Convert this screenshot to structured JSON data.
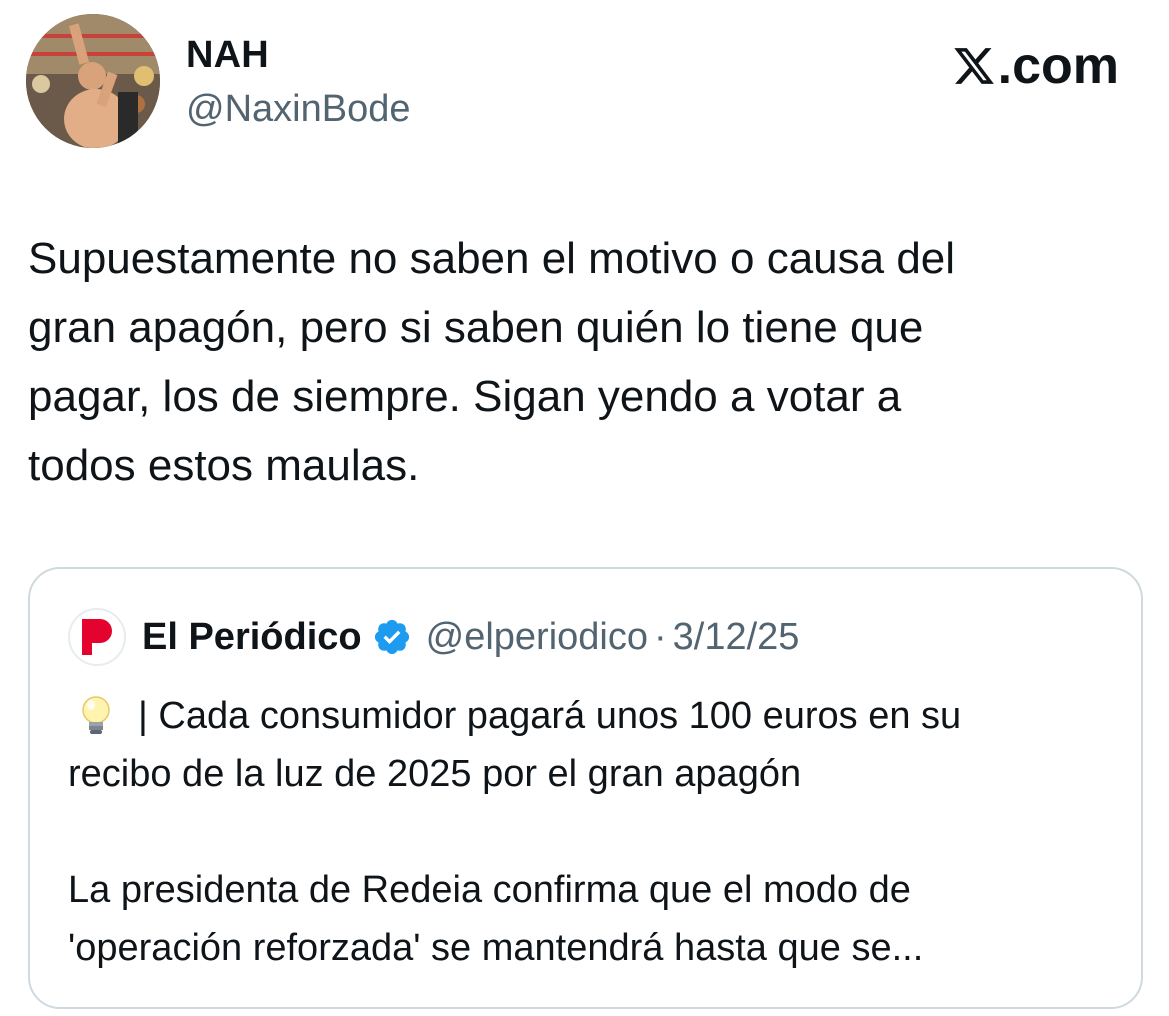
{
  "author": {
    "name": "NAH",
    "handle": "@NaxinBode"
  },
  "brand": {
    "label": ".com",
    "icon": "x-logo-icon"
  },
  "tweet": {
    "text": "Supuestamente no saben el motivo o causa del\ngran apagón, pero si saben quién lo tiene que\npagar, los de siempre. Sigan yendo a votar a\ntodos estos maulas."
  },
  "quote": {
    "logo_icon": "el-periodico-logo-icon",
    "name": "El Periódico",
    "verified_icon": "verified-badge-icon",
    "handle": "@elperiodico",
    "separator": "·",
    "date": "3/12/25",
    "emoji_icon": "light-bulb-icon",
    "line1": "| Cada consumidor pagará unos 100 euros en su",
    "line2": "recibo de la luz de 2025 por el gran apagón",
    "para2": "La presidenta de Redeia confirma que el modo de\n'operación reforzada' se mantendrá hasta que se..."
  },
  "colors": {
    "text": "#0f1419",
    "secondary": "#536471",
    "border": "#cfd9de",
    "verified": "#1d9bf0",
    "periodico_red": "#e4032e"
  }
}
